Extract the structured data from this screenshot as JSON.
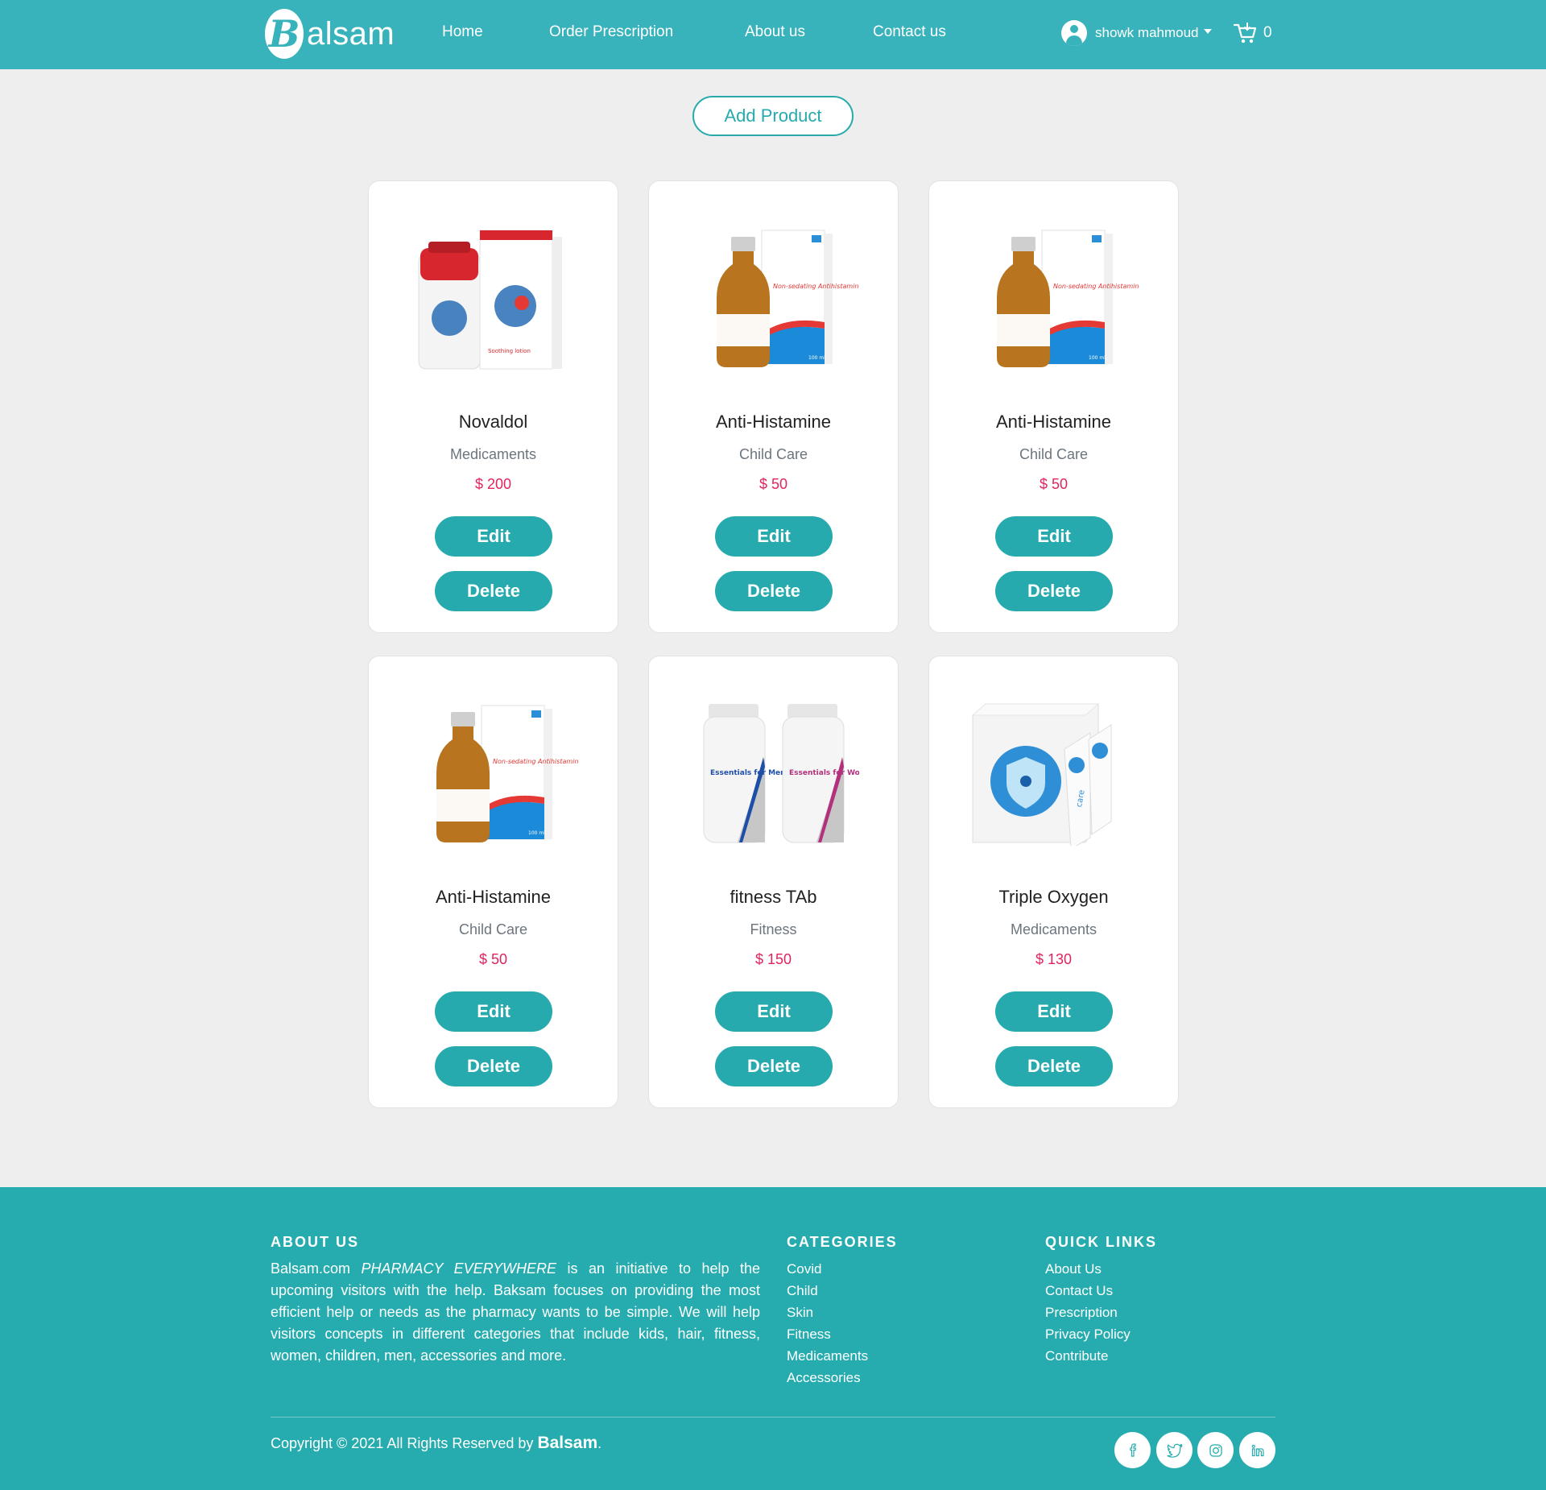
{
  "nav": {
    "logo_letter": "B",
    "logo_text": "alsam",
    "links": [
      "Home",
      "Order Prescription",
      "About us",
      "Contact us"
    ],
    "user_name": "showk mahmoud",
    "cart_count": "0"
  },
  "main": {
    "add_button": "Add Product"
  },
  "products": [
    {
      "name": "Novaldol",
      "category": "Medicaments",
      "price": "$ 200",
      "image": "lotion-box-image",
      "edit": "Edit",
      "delete": "Delete"
    },
    {
      "name": "Anti-Histamine",
      "category": "Child Care",
      "price": "$ 50",
      "image": "syrup-bottle-image",
      "edit": "Edit",
      "delete": "Delete"
    },
    {
      "name": "Anti-Histamine",
      "category": "Child Care",
      "price": "$ 50",
      "image": "syrup-bottle-image",
      "edit": "Edit",
      "delete": "Delete"
    },
    {
      "name": "Anti-Histamine",
      "category": "Child Care",
      "price": "$ 50",
      "image": "syrup-bottle-image",
      "edit": "Edit",
      "delete": "Delete"
    },
    {
      "name": "fitness TAb",
      "category": "Fitness",
      "price": "$ 150",
      "image": "vitamin-bottles-image",
      "edit": "Edit",
      "delete": "Delete"
    },
    {
      "name": "Triple Oxygen",
      "category": "Medicaments",
      "price": "$ 130",
      "image": "sachet-box-image",
      "edit": "Edit",
      "delete": "Delete"
    }
  ],
  "product_images": {
    "novaldol_box_text": "Soothing lotion",
    "syrup_box_text": "Non-sedating Antihistamine",
    "syrup_volume": "100 ml",
    "vitamin_men": "Essentials for Men",
    "vitamin_women": "Essentials for Women",
    "sachet_text": "care"
  },
  "footer": {
    "about_title": "ABOUT US",
    "about_brand": "Balsam.com",
    "about_tagline": "PHARMACY EVERYWHERE",
    "about_text": "is an initiative to help the upcoming visitors with the help. Baksam focuses on providing the most efficient help or needs as the pharmacy wants to be simple. We will help visitors concepts in different categories that include kids, hair, fitness, women, children, men, accessories and more.",
    "categories_title": "CATEGORIES",
    "categories": [
      "Covid",
      "Child",
      "Skin",
      "Fitness",
      "Medicaments",
      "Accessories"
    ],
    "quick_title": "QUICK LINKS",
    "quick_links": [
      "About Us",
      "Contact Us",
      "Prescription",
      "Privacy Policy",
      "Contribute"
    ],
    "copyright": "Copyright © 2021 All Rights Reserved by",
    "copyright_brand": "Balsam",
    "copyright_end": ".",
    "social": [
      "facebook-icon",
      "twitter-icon",
      "instagram-icon",
      "linkedin-icon"
    ]
  },
  "colors": {
    "nav_bg": "#39b3bb",
    "accent": "#26aaae",
    "footer_bg": "#26acaf",
    "price": "#e0245e",
    "page_bg": "#eeeeee"
  }
}
